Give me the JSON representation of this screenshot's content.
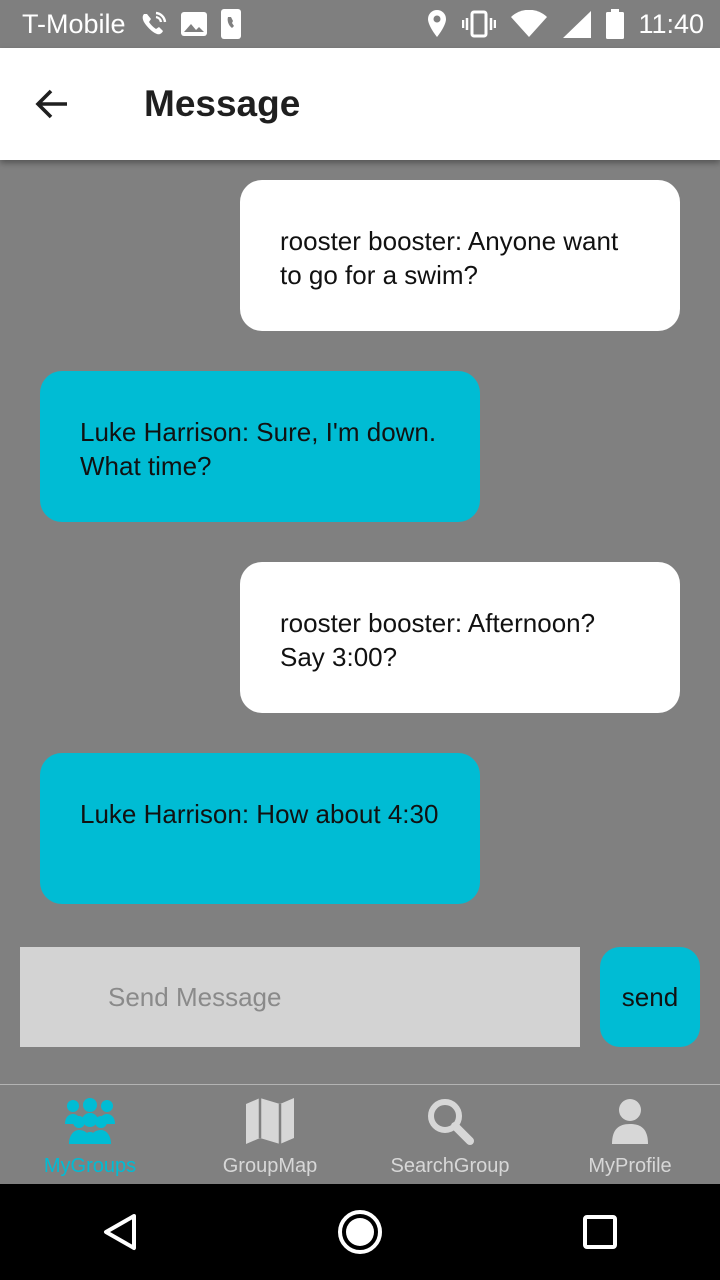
{
  "status_bar": {
    "carrier": "T-Mobile",
    "time": "11:40",
    "icons": [
      "wifi-calling-icon",
      "image-icon",
      "phone-icon",
      "location-icon",
      "vibrate-icon",
      "wifi-icon",
      "signal-icon",
      "battery-icon"
    ]
  },
  "header": {
    "back_icon": "arrow-back-icon",
    "title": "Message"
  },
  "messages": [
    {
      "direction": "outgoing",
      "text": "rooster booster: Anyone want to go for a swim?"
    },
    {
      "direction": "incoming",
      "text": "Luke Harrison: Sure, I'm down. What time?"
    },
    {
      "direction": "outgoing",
      "text": "rooster booster: Afternoon? Say 3:00?"
    },
    {
      "direction": "incoming",
      "text": "Luke Harrison: How about 4:30"
    }
  ],
  "composer": {
    "value": "",
    "placeholder": "Send Message",
    "send_label": "send"
  },
  "bottom_nav": {
    "active_index": 0,
    "items": [
      {
        "label": "MyGroups",
        "icon": "groups-icon"
      },
      {
        "label": "GroupMap",
        "icon": "map-icon"
      },
      {
        "label": "SearchGroup",
        "icon": "search-icon"
      },
      {
        "label": "MyProfile",
        "icon": "profile-icon"
      }
    ]
  },
  "colors": {
    "accent": "#00bcd4",
    "background": "#808080",
    "outgoing_bubble": "#ffffff",
    "input_background": "#d3d3d3"
  }
}
